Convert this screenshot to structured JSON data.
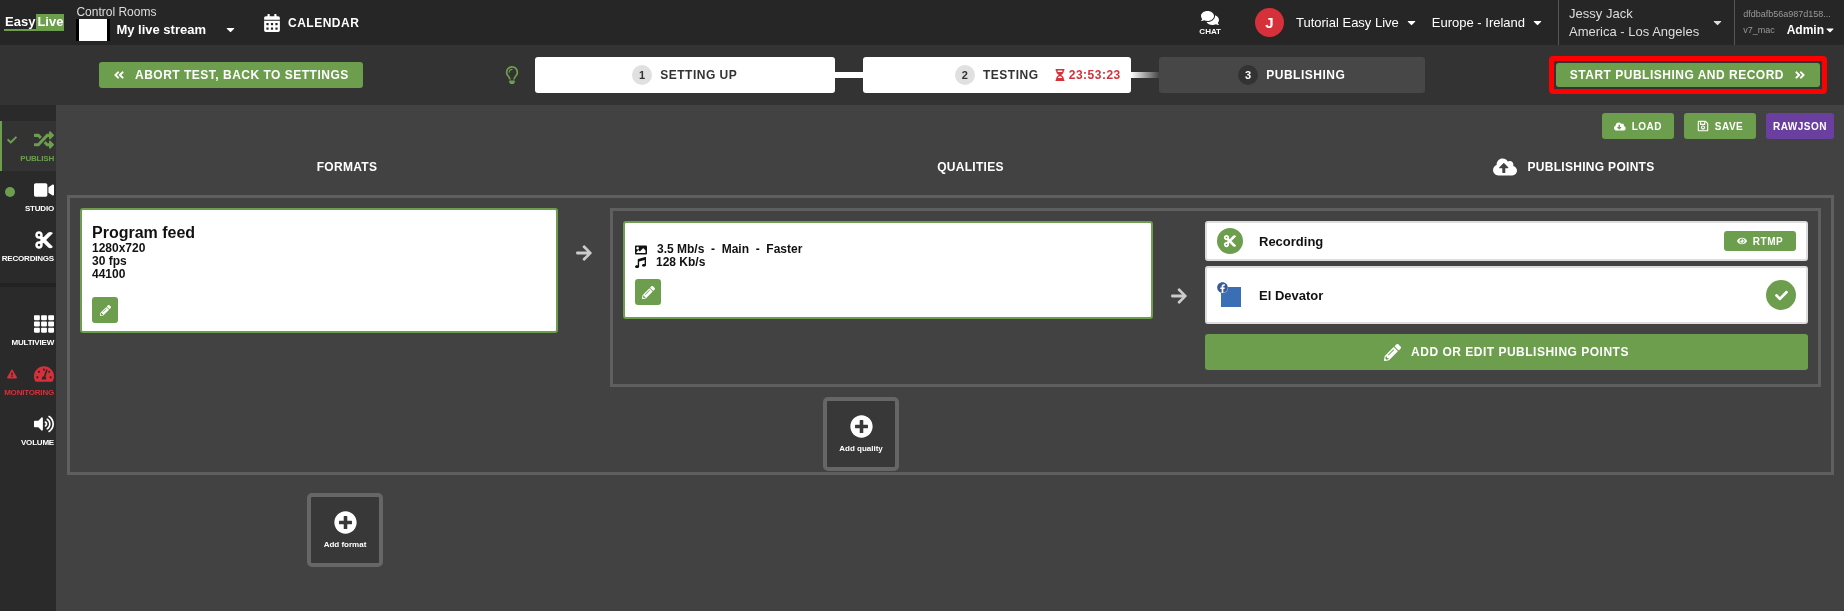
{
  "top_bar": {
    "logo": {
      "first": "Easy",
      "second": "Live"
    },
    "control_rooms": {
      "label": "Control Rooms",
      "value": "My live stream"
    },
    "calendar": "CALENDAR",
    "chat": "CHAT",
    "user_initial": "J",
    "organization": "Tutorial Easy Live",
    "region": "Europe - Ireland",
    "account": {
      "name": "Jessy Jack",
      "timezone": "America - Los Angeles"
    },
    "session": {
      "id": "dfdbafb56a987d158...",
      "version": "v7_mac",
      "role": "Admin"
    }
  },
  "steps_bar": {
    "abort_button": "ABORT TEST, BACK TO SETTINGS",
    "steps": [
      {
        "number": "1",
        "label": "SETTING UP",
        "reached": true
      },
      {
        "number": "2",
        "label": "TESTING",
        "reached": true,
        "timer": "23:53:23"
      },
      {
        "number": "3",
        "label": "PUBLISHING",
        "reached": false
      }
    ],
    "start_button": {
      "label": "START PUBLISHING AND RECORD",
      "highlighted": true
    }
  },
  "sidebar": {
    "groups": [
      {
        "items": [
          {
            "label": "PUBLISH",
            "selected": true,
            "checked": true,
            "live": false,
            "warning": false
          },
          {
            "label": "STUDIO",
            "selected": false,
            "checked": false,
            "live": true,
            "warning": false
          },
          {
            "label": "RECORDINGS",
            "selected": false,
            "checked": false,
            "live": false,
            "warning": false
          }
        ]
      },
      {
        "items": [
          {
            "label": "MULTIVIEW",
            "selected": false,
            "checked": false,
            "live": false,
            "warning": false
          },
          {
            "label": "MONITORING",
            "selected": false,
            "checked": false,
            "live": false,
            "warning": true
          },
          {
            "label": "VOLUME",
            "selected": false,
            "checked": false,
            "live": false,
            "warning": false
          }
        ]
      }
    ]
  },
  "toolbar": [
    {
      "label": "LOAD",
      "color": "#6d9e4e"
    },
    {
      "label": "SAVE",
      "color": "#6d9e4e"
    },
    {
      "label": "RAWJSON",
      "color": "#6b3fa0"
    }
  ],
  "columns": [
    "FORMATS",
    "QUALITIES",
    "PUBLISHING POINTS"
  ],
  "formats": [
    {
      "title": "Program feed",
      "lines": [
        "1280x720",
        "30 fps",
        "44100"
      ]
    }
  ],
  "qualities": [
    {
      "video": "3.5 Mb/s  -  Main  -  Faster",
      "audio": "128 Kb/s"
    }
  ],
  "publishing_points": [
    {
      "kind": "recording",
      "name": "Recording",
      "action": "RTMP"
    },
    {
      "kind": "facebook",
      "name": "El Devator",
      "checked": true
    }
  ],
  "add_publishing_points": "ADD OR EDIT PUBLISHING POINTS",
  "add_quality": "Add quality",
  "add_format": "Add format"
}
